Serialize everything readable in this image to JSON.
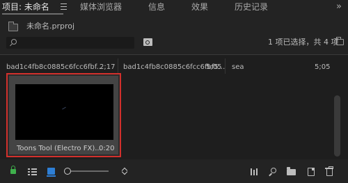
{
  "tabs": [
    {
      "label": "项目: 未命名",
      "active": true
    },
    {
      "label": "媒体浏览器",
      "active": false
    },
    {
      "label": "信息",
      "active": false
    },
    {
      "label": "效果",
      "active": false
    },
    {
      "label": "历史记录",
      "active": false
    }
  ],
  "overflow_label": "»",
  "project": {
    "name": "未命名.prproj"
  },
  "search": {
    "value": "",
    "placeholder": ""
  },
  "status": {
    "selection_text": "1 项已选择，共 4 项"
  },
  "clips": [
    {
      "name": "bad1c4fb8c0885c6fcc6fbf...",
      "duration": "2;17"
    },
    {
      "name": "bad1c4fb8c0885c6fcc6fbf5...",
      "duration": "5;05"
    },
    {
      "name": "sea",
      "duration": "5;05"
    }
  ],
  "selected_clip": {
    "name": "Toons Tool (Electro FX)...",
    "duration": "0:20"
  },
  "colors": {
    "selection_border": "#d2302c",
    "lock_green": "#3fb04c",
    "accent_blue": "#2e7fd6"
  },
  "icons": [
    "bin-icon",
    "search-icon",
    "new-search-bin-icon",
    "folder-icon",
    "lock-icon",
    "list-view-icon",
    "icon-view-icon",
    "sort-icon",
    "automate-icon",
    "find-icon",
    "new-bin-icon",
    "new-item-icon",
    "delete-icon"
  ]
}
